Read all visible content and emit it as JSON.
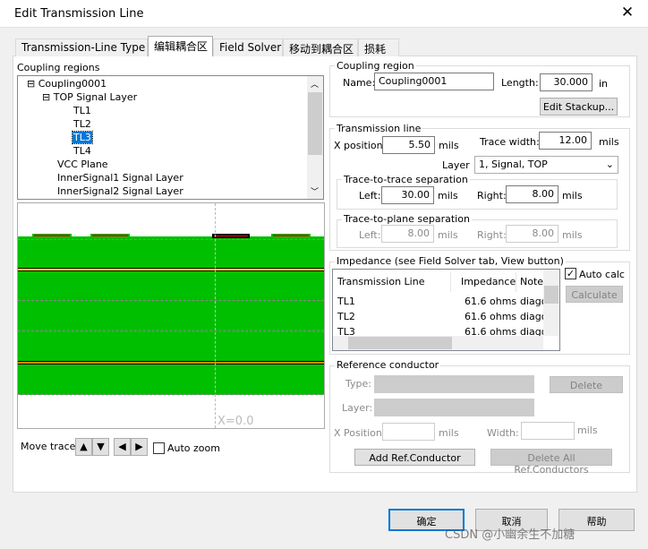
{
  "window": {
    "title": "Edit Transmission Line",
    "close_icon": "close-icon"
  },
  "tabs": [
    {
      "label": "Transmission-Line Type"
    },
    {
      "label": "编辑耦合区"
    },
    {
      "label": "Field Solver"
    },
    {
      "label": "移动到耦合区"
    },
    {
      "label": "损耗"
    }
  ],
  "active_tab": 1,
  "left": {
    "coupling_regions_label": "Coupling regions",
    "tree": [
      {
        "label": "Coupling0001",
        "expander": "⊟"
      },
      {
        "label": "TOP Signal Layer",
        "expander": "⊟"
      },
      {
        "label": "TL1"
      },
      {
        "label": "TL2"
      },
      {
        "label": "TL3",
        "selected": true
      },
      {
        "label": "TL4"
      },
      {
        "label": "VCC Plane"
      },
      {
        "label": "InnerSignal1 Signal Layer"
      },
      {
        "label": "InnerSignal2 Signal Layer"
      }
    ],
    "preview": {
      "x_readout": "X=0.0",
      "colors": {
        "dielectric": "#00bf00",
        "trace": "#ff0000",
        "selected_trace": "#000000",
        "plane1": "#ffff00",
        "plane2": "#ff8000"
      }
    },
    "move_trace_label": "Move trace:",
    "auto_zoom_label": "Auto zoom",
    "auto_zoom_checked": false
  },
  "coupling_region": {
    "group": "Coupling region",
    "name_label": "Name:",
    "name_value": "Coupling0001",
    "length_label": "Length:",
    "length_value": "30.000",
    "length_unit": "in",
    "edit_stackup": "Edit Stackup..."
  },
  "transmission_line": {
    "group": "Transmission line",
    "x_label": "X position:",
    "x_value": "5.50",
    "x_unit": "mils",
    "tw_label": "Trace width:",
    "tw_value": "12.00",
    "tw_unit": "mils",
    "layer_label": "Layer",
    "layer_value": "1, Signal, TOP",
    "tt": {
      "group": "Trace-to-trace separation",
      "left_label": "Left:",
      "left_value": "30.00",
      "left_unit": "mils",
      "right_label": "Right:",
      "right_value": "8.00",
      "right_unit": "mils"
    },
    "tp": {
      "group": "Trace-to-plane separation",
      "left_label": "Left:",
      "left_value": "8.00",
      "left_unit": "mils",
      "right_label": "Right:",
      "right_value": "8.00",
      "right_unit": "mils"
    }
  },
  "impedance": {
    "group": "Impedance (see Field Solver tab, View button)",
    "columns": [
      "Transmission Line",
      "Impedance",
      "Notes"
    ],
    "rows": [
      {
        "tl": "TL1",
        "imp": "61.6 ohms",
        "notes": "diago"
      },
      {
        "tl": "TL2",
        "imp": "61.6 ohms",
        "notes": "diago"
      },
      {
        "tl": "TL3",
        "imp": "61.6 ohms",
        "notes": "diago"
      }
    ],
    "auto_calc_label": "Auto calc",
    "auto_calc_checked": true,
    "calculate": "Calculate"
  },
  "reference": {
    "group": "Reference conductor",
    "type_label": "Type:",
    "layer_label": "Layer:",
    "xpos_label": "X Position:",
    "xpos_unit": "mils",
    "width_label": "Width:",
    "width_unit": "mils",
    "delete": "Delete",
    "add": "Add Ref.Conductor",
    "delete_all": "Delete All Ref.Conductors"
  },
  "footer": {
    "ok": "确定",
    "cancel": "取消",
    "help": "帮助",
    "watermark": "CSDN @小幽余生不加糖"
  }
}
